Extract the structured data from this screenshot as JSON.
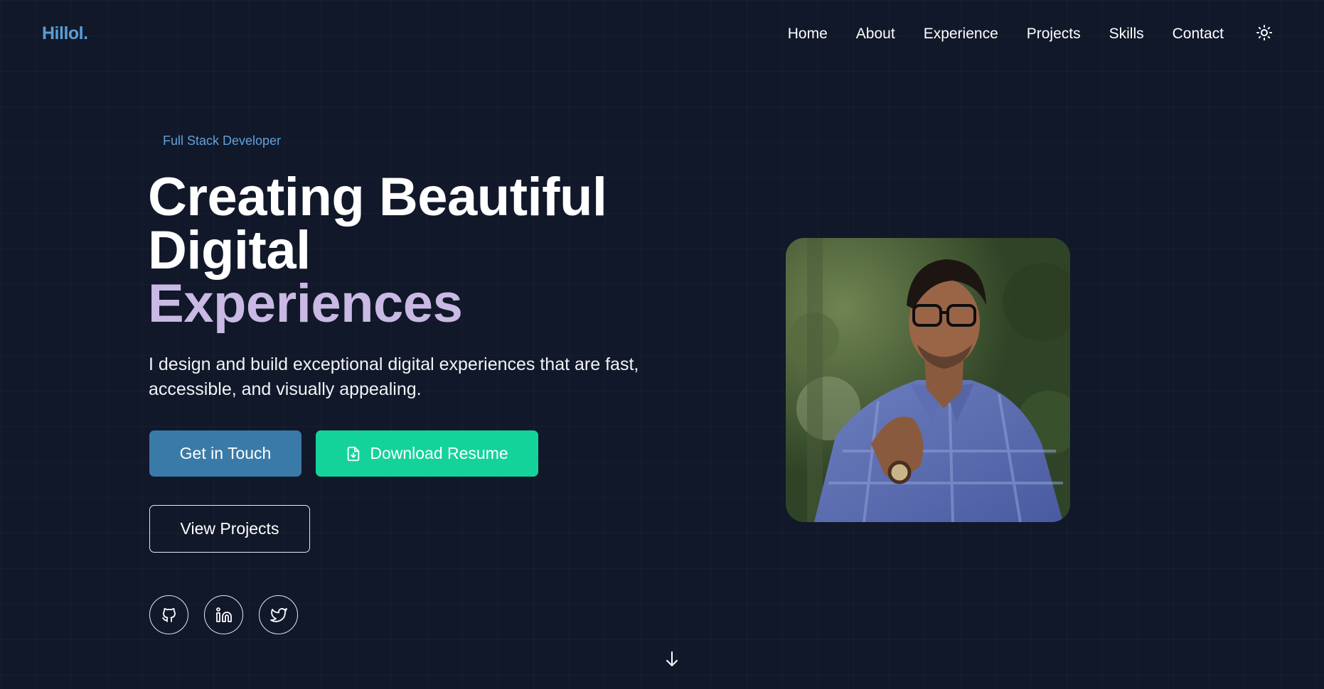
{
  "brand": {
    "logo": "Hillol."
  },
  "nav": {
    "items": [
      "Home",
      "About",
      "Experience",
      "Projects",
      "Skills",
      "Contact"
    ],
    "theme_toggle_icon": "sun-icon"
  },
  "hero": {
    "eyebrow": "Full Stack Developer",
    "headline_line1": "Creating Beautiful",
    "headline_line2": "Digital",
    "headline_accent": "Experiences",
    "subtitle": "I design and build exceptional digital experiences that are fast, accessible, and visually appealing.",
    "buttons": {
      "touch": "Get in Touch",
      "resume": "Download Resume",
      "projects": "View Projects"
    },
    "social_icons": [
      "github-icon",
      "linkedin-icon",
      "twitter-icon"
    ],
    "scroll_icon": "arrow-down-icon"
  },
  "colors": {
    "background": "#111829",
    "logo": "#5a9ed6",
    "accent_text": "#cab9e4",
    "button_primary": "#3a7aa8",
    "button_resume": "#14d39a"
  }
}
